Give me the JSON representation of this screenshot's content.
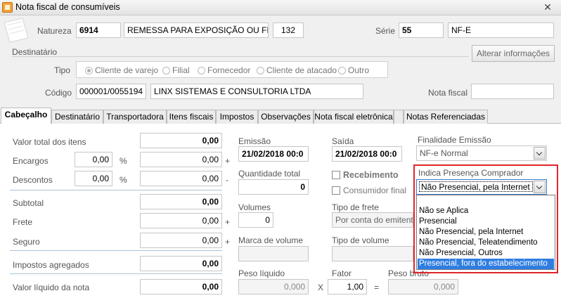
{
  "window": {
    "title": "Nota fiscal de consumíveis",
    "close": "✕"
  },
  "header": {
    "natureza_label": "Natureza",
    "natureza_code": "6914",
    "natureza_desc": "REMESSA PARA EXPOSIÇÃO OU FEIRA",
    "natureza_num": "132",
    "serie_label": "Série",
    "serie_value": "55",
    "serie_type": "NF-E",
    "destinatario_label": "Destinatário",
    "alterar_button": "Alterar informações",
    "tipo_label": "Tipo",
    "tipo_options": [
      "Cliente de varejo",
      "Filial",
      "Fornecedor",
      "Cliente de atacado",
      "Outro"
    ],
    "codigo_label": "Código",
    "codigo_value": "000001/0055194",
    "cliente_nome": "LINX SISTEMAS E CONSULTORIA  LTDA",
    "nota_fiscal_label": "Nota fiscal",
    "nota_fiscal_value": ""
  },
  "tabs": [
    "Cabeçalho",
    "Destinatário",
    "Transportadora",
    "Itens fiscais",
    "Impostos",
    "Observações",
    "Nota fiscal eletrônica",
    "Notas Referenciadas"
  ],
  "totals": {
    "valor_total_label": "Valor total dos itens",
    "valor_total": "0,00",
    "encargos_label": "Encargos",
    "encargos_pct": "0,00",
    "encargos_val": "0,00",
    "descontos_label": "Descontos",
    "descontos_pct": "0,00",
    "descontos_val": "0,00",
    "subtotal_label": "Subtotal",
    "subtotal": "0,00",
    "frete_label": "Frete",
    "frete": "0,00",
    "seguro_label": "Seguro",
    "seguro": "0,00",
    "impostos_label": "Impostos agregados",
    "impostos": "0,00",
    "liquido_label": "Valor líquido da nota",
    "liquido": "0,00",
    "pct": "%",
    "plus": "+",
    "minus": "-"
  },
  "middle": {
    "emissao_label": "Emissão",
    "emissao": "21/02/2018 00:0",
    "saida_label": "Saída",
    "saida": "21/02/2018 00:0",
    "qtd_label": "Quantidade total",
    "qtd": "0",
    "recebimento_label": "Recebimento",
    "consumidor_label": "Consumidor final",
    "volumes_label": "Volumes",
    "volumes": "0",
    "tipo_frete_label": "Tipo de frete",
    "tipo_frete": "Por conta do emitente",
    "marca_label": "Marca de volume",
    "marca": "",
    "tipo_volume_label": "Tipo de volume",
    "tipo_volume": "",
    "peso_liquido_label": "Peso líquido",
    "peso_liquido": "0,000",
    "fator_label": "Fator",
    "fator": "1,00",
    "peso_bruto_label": "Peso bruto",
    "peso_bruto": "0,000",
    "times": "X",
    "equals": "="
  },
  "right": {
    "finalidade_label": "Finalidade Emissão",
    "finalidade": "NF-e Normal",
    "presenca_label": "Indica Presença Comprador",
    "presenca": "Não Presencial, pela Internet",
    "presenca_options": [
      "Não se Aplica",
      "Presencial",
      "Não Presencial, pela Internet",
      "Não Presencial, Teleatendimento",
      "Não Presencial, Outros",
      "Presencial, fora do estabelecimento"
    ],
    "highlight_color": "#e0252b",
    "selection_color": "#2f7de1"
  }
}
